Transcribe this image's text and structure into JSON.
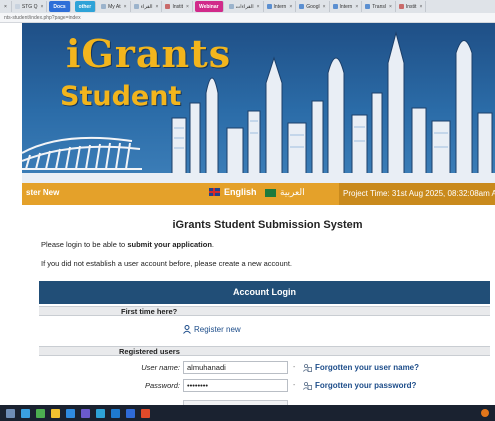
{
  "browser": {
    "tabs": [
      {
        "label": "STG Q",
        "color": "#c9d3df"
      },
      {
        "label": "Docs",
        "color": "#2e6fd8",
        "pill": true
      },
      {
        "label": "other",
        "color": "#2ea3d8",
        "pill": true
      },
      {
        "label": "My At",
        "color": "#9bb3cc"
      },
      {
        "label": "القراء",
        "color": "#9bb3cc"
      },
      {
        "label": "Instit",
        "color": "#c96a6a"
      },
      {
        "label": "Webinar",
        "color": "#d12a8a",
        "pill": true
      },
      {
        "label": "القراءات",
        "color": "#9bb3cc"
      },
      {
        "label": "Intern",
        "color": "#5b8fd1"
      },
      {
        "label": "Googl",
        "color": "#5b8fd1"
      },
      {
        "label": "Intern",
        "color": "#5b8fd1"
      },
      {
        "label": "Transl",
        "color": "#5b8fd1"
      },
      {
        "label": "Instit",
        "color": "#c96a6a"
      }
    ],
    "address": "nts-student/index.php?page=index"
  },
  "banner": {
    "brand": "iGrants",
    "sub": "Student"
  },
  "topbar": {
    "register": "ster New",
    "english": "English",
    "arabic": "العربية",
    "project_time": "Project Time: 31st Aug 2025, 08:32:08am As"
  },
  "main": {
    "title": "iGrants Student Submission System",
    "intro1_pre": "Please login to be able to ",
    "intro1_bold": "submit your application",
    "intro1_post": ".",
    "intro2": "If you did not establish a user account before, please create a new account."
  },
  "login": {
    "panel_title": "Account Login",
    "first_time": "First time here?",
    "register_new": "Register new",
    "registered_users": "Registered users",
    "username_label": "User name:",
    "username_value": "almuhanadi",
    "password_label": "Password:",
    "password_value": "••••••••",
    "dash": "-",
    "forgot_username": "Forgotten your user name?",
    "forgot_password": "Forgotten your password?"
  },
  "taskbar": {
    "icons": [
      "windows-icon",
      "edge-icon",
      "chrome-icon",
      "files-icon",
      "store-icon",
      "teams-icon",
      "photos-icon",
      "mail-icon",
      "word-icon",
      "media-icon"
    ],
    "colors": [
      "#6e8db5",
      "#3aa0e0",
      "#4caf50",
      "#f2c230",
      "#2f8be0",
      "#6a5acd",
      "#2ea3d8",
      "#1e7ad0",
      "#2f6bd8",
      "#e04a2a"
    ]
  },
  "colors": {
    "orange": "#e4a12a",
    "panel": "#214e77",
    "link": "#1d4d8a",
    "brand": "#f2b51d"
  }
}
